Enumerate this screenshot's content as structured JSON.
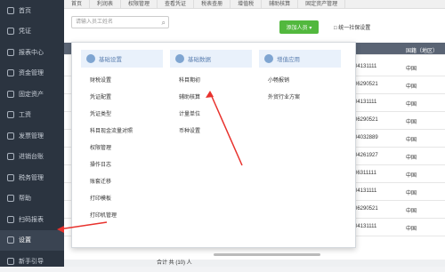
{
  "sidebar": {
    "items": [
      {
        "label": "首页",
        "icon": "home-icon"
      },
      {
        "label": "凭证",
        "icon": "voucher-icon"
      },
      {
        "label": "报表中心",
        "icon": "report-icon"
      },
      {
        "label": "资金管理",
        "icon": "fund-icon"
      },
      {
        "label": "固定资产",
        "icon": "asset-icon"
      },
      {
        "label": "工资",
        "icon": "salary-icon"
      },
      {
        "label": "发票管理",
        "icon": "invoice-icon"
      },
      {
        "label": "进销台账",
        "icon": "ledger-icon"
      },
      {
        "label": "税务管理",
        "icon": "tax-icon"
      },
      {
        "label": "帮助",
        "icon": "help-icon"
      },
      {
        "label": "扫码报表",
        "icon": "scan-icon"
      },
      {
        "label": "设置",
        "icon": "settings-icon",
        "active": true
      },
      {
        "label": "新手引导",
        "icon": "guide-icon"
      }
    ]
  },
  "tabs": [
    "首页",
    "利润表",
    "权限管理",
    "查看凭证",
    "税表查册",
    "增值税",
    "辅助核算",
    "固定资产管理"
  ],
  "toolbar": {
    "search_placeholder": "请输入员工姓名",
    "add_label": "添加人员 ▾",
    "print_label": "□ 统一社保设置"
  },
  "table": {
    "header_country": "国籍（地区）",
    "rows": [
      {
        "tax": "04131111",
        "country": "中国"
      },
      {
        "tax": "06290521",
        "country": "中国"
      },
      {
        "tax": "04131111",
        "country": "中国"
      },
      {
        "tax": "06290521",
        "country": "中国"
      },
      {
        "tax": "04032889",
        "country": "中国"
      },
      {
        "tax": "04261927",
        "country": "中国"
      },
      {
        "tax": "06311111",
        "country": "中国"
      },
      {
        "tax": "04131111",
        "country": "中国"
      },
      {
        "tax": "06290521",
        "country": "中国"
      },
      {
        "tax": "04131111",
        "country": "中国"
      }
    ],
    "total": "合计 共 (10) 人"
  },
  "popup": {
    "columns": [
      {
        "title": "基础设置",
        "items": [
          "财税设置",
          "凭证配置",
          "凭证类型",
          "科目现金流量对照",
          "权限管理",
          "操作日志",
          "账套迁移",
          "打印模板",
          "打印机管理"
        ]
      },
      {
        "title": "基础数据",
        "items": [
          "科目期初",
          "辅助核算",
          "计量单位",
          "币种设置"
        ]
      },
      {
        "title": "增值应用",
        "items": [
          "小畅报销",
          "外贸行业方案"
        ]
      }
    ]
  },
  "colors": {
    "sidebar_bg": "#2b3440",
    "accent_green": "#52b83e",
    "arrow_red": "#e8322d"
  }
}
